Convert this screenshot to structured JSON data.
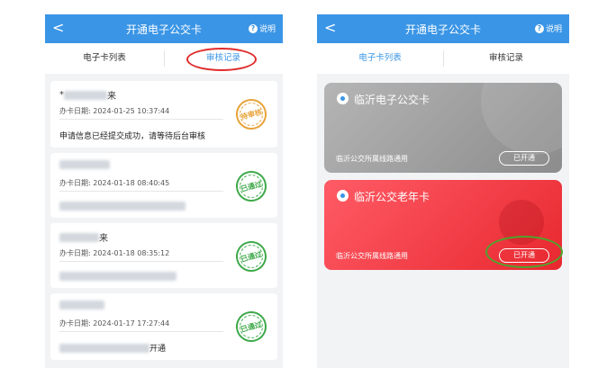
{
  "left": {
    "header": {
      "title": "开通电子公交卡",
      "back": "<",
      "help": "说明",
      "help_icon": "?"
    },
    "tabs": [
      "电子卡列表",
      "审核记录"
    ],
    "records": [
      {
        "name": "*",
        "name_tail": "来",
        "date": "办卡日期: 2024-01-25 10:37:44",
        "message": "申请信息已经提交成功，请等待后台审核",
        "status": "待审核"
      },
      {
        "name": "",
        "name_tail": "",
        "date": "办卡日期: 2024-01-18 08:40:45",
        "message": "",
        "message_tail": "",
        "status": "已通过"
      },
      {
        "name": "",
        "name_tail": "来",
        "date": "办卡日期: 2024-01-18 08:35:12",
        "message": "",
        "message_tail": "",
        "status": "已通过"
      },
      {
        "name": "",
        "name_tail": "",
        "date": "办卡日期: 2024-01-17 17:27:44",
        "message": "",
        "message_tail": "开通",
        "status": "已通过"
      }
    ]
  },
  "right": {
    "header": {
      "title": "开通电子公交卡",
      "back": "<",
      "help": "说明",
      "help_icon": "?"
    },
    "tabs": [
      "电子卡列表",
      "审核记录"
    ],
    "cards": [
      {
        "name": "临沂电子公交卡",
        "route": "临沂公交所属线路通用",
        "button": "已开通",
        "color": "#9e9e9e"
      },
      {
        "name": "临沂公交老年卡",
        "route": "临沂公交所属线路通用",
        "button": "已开通",
        "color": "#f0404a"
      }
    ]
  },
  "colors": {
    "accent": "#3a95e6",
    "pending": "#e8a33a",
    "approved": "#3fa94a",
    "annotation_red": "#e02b2b",
    "annotation_green": "#4ca52d"
  }
}
